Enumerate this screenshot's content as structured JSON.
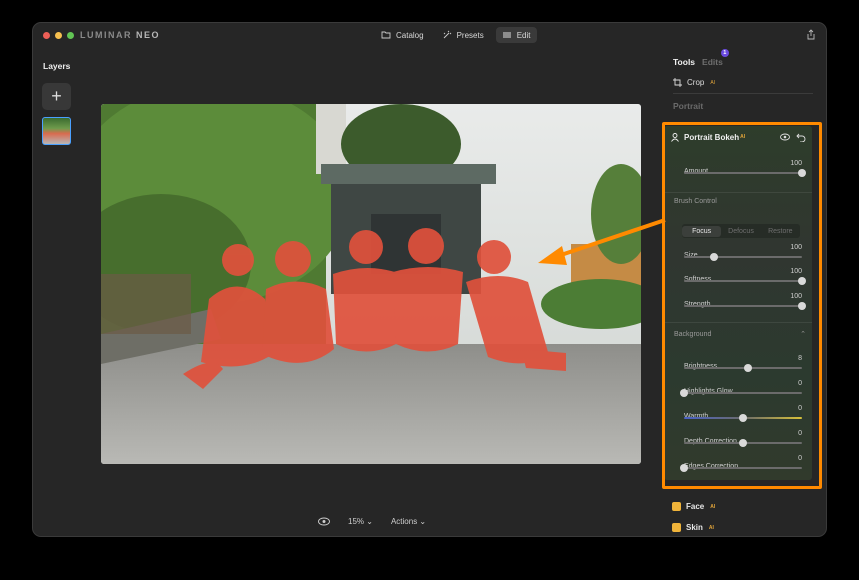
{
  "app": {
    "brand_main": "LUMINAR",
    "brand_sub": "NEO"
  },
  "topnav": {
    "catalog": "Catalog",
    "presets": "Presets",
    "edit": "Edit"
  },
  "layers": {
    "title": "Layers",
    "add": "+"
  },
  "bottombar": {
    "zoom": "15%",
    "zoom_chevron": "⌄",
    "actions": "Actions",
    "actions_chevron": "⌄"
  },
  "tools": {
    "tab_tools": "Tools",
    "tab_edits": "Edits",
    "edits_badge": "1",
    "crop_label": "Crop",
    "ai_tag": "AI",
    "portrait_heading": "Portrait"
  },
  "portrait_bokeh": {
    "title": "Portrait Bokeh",
    "amount": {
      "label": "Amount",
      "value": "100",
      "fraction": 1.0
    },
    "brush_control_label": "Brush Control",
    "modes": [
      "Focus",
      "Defocus",
      "Restore"
    ],
    "active_mode": "Focus",
    "size": {
      "label": "Size",
      "value": "100",
      "fraction": 0.25
    },
    "softness": {
      "label": "Softness",
      "value": "100",
      "fraction": 1.0
    },
    "strength": {
      "label": "Strength",
      "value": "100",
      "fraction": 1.0
    },
    "background_label": "Background",
    "brightness": {
      "label": "Brightness",
      "value": "8",
      "fraction": 0.54
    },
    "highlights_glow": {
      "label": "Highlights Glow",
      "value": "0",
      "fraction": 0.0
    },
    "warmth": {
      "label": "Warmth",
      "value": "0",
      "fraction": 0.5
    },
    "depth_correction": {
      "label": "Depth Correction",
      "value": "0",
      "fraction": 0.5
    },
    "edges_correction": {
      "label": "Edges Correction",
      "value": "0",
      "fraction": 0.0
    }
  },
  "bottom_tools": {
    "face": "Face",
    "skin": "Skin"
  },
  "colors": {
    "accent_orange": "#ff8a00",
    "badge_purple": "#6b4be0",
    "mask_red": "#e0513c"
  },
  "icons": [
    "folder-icon",
    "presets-icon",
    "sliders-icon",
    "share-icon",
    "crop-icon",
    "eye-icon",
    "undo-icon",
    "portrait-bokeh-icon"
  ]
}
